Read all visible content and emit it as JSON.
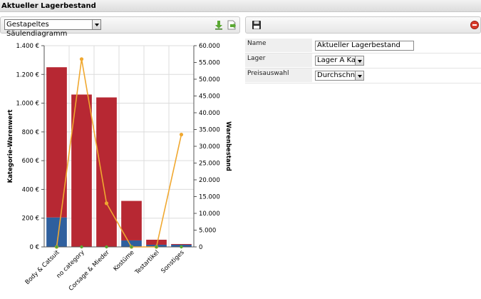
{
  "window": {
    "title": "Aktueller Lagerbestand"
  },
  "toolbar_left": {
    "chart_type_value": "Gestapeltes Säulendiagramm",
    "download_icon": "download-arrow-icon",
    "export_icon": "export-document-icon"
  },
  "toolbar_right": {
    "save_icon": "floppy-disk-icon",
    "delete_icon": "red-delete-circle-icon"
  },
  "properties": [
    {
      "label": "Name",
      "value": "Aktueller Lagerbestand",
      "kind": "text"
    },
    {
      "label": "Lager",
      "value": "Lager A Kass",
      "kind": "select"
    },
    {
      "label": "Preisauswahl",
      "value": "Durchschnittl",
      "kind": "select"
    }
  ],
  "chart_data": {
    "type": "bar",
    "stacked": true,
    "categories": [
      "Body & Catsuit",
      "no category",
      "Corsage & Mieder",
      "Kostüme",
      "Testartikel",
      "Sonstiges"
    ],
    "ylabel": "Kategorie-Warenwert",
    "y2label": "Warenbestand",
    "ylim": [
      0,
      1400
    ],
    "y2lim": [
      0,
      60000
    ],
    "yticks": [
      "0 €",
      "200 €",
      "400 €",
      "600 €",
      "800 €",
      "1.000 €",
      "1.200 €",
      "1.400 €"
    ],
    "y2ticks": [
      "0",
      "5.000",
      "10.000",
      "15.000",
      "20.000",
      "25.000",
      "30.000",
      "35.000",
      "40.000",
      "45.000",
      "50.000",
      "55.000",
      "60.000"
    ],
    "series": [
      {
        "color": "#2e5f9e",
        "values": [
          205,
          0,
          0,
          45,
          15,
          15
        ]
      },
      {
        "color": "#b72833",
        "values": [
          1045,
          1060,
          1040,
          275,
          35,
          5
        ]
      }
    ],
    "line_series": {
      "color": "#f0a830",
      "values": [
        0,
        56000,
        13000,
        0,
        0,
        33500
      ]
    },
    "marker_color": "#5aa832",
    "grid": true
  }
}
